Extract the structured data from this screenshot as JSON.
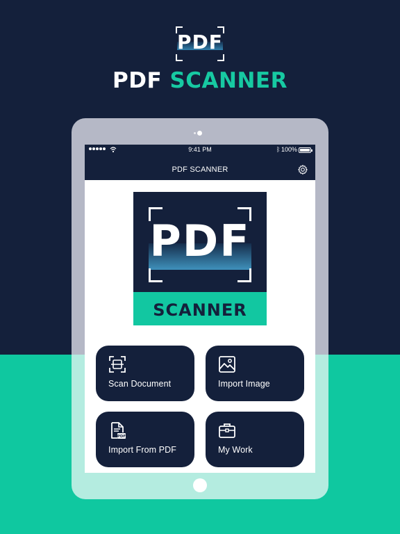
{
  "hero": {
    "logo_text": "PDF",
    "title_part1": "PDF",
    "title_part2": "SCANNER"
  },
  "status_bar": {
    "time": "9:41 PM",
    "battery": "100%"
  },
  "app_bar": {
    "title": "PDF SCANNER"
  },
  "app_logo": {
    "pdf_text": "PDF",
    "band_text": "SCANNER"
  },
  "actions": [
    {
      "label": "Scan Document",
      "icon": "scan-document-icon"
    },
    {
      "label": "Import Image",
      "icon": "image-icon"
    },
    {
      "label": "Import From PDF",
      "icon": "pdf-file-icon"
    },
    {
      "label": "My Work",
      "icon": "briefcase-icon"
    }
  ],
  "colors": {
    "navy": "#14203b",
    "teal": "#0fc8a0",
    "white": "#ffffff"
  }
}
